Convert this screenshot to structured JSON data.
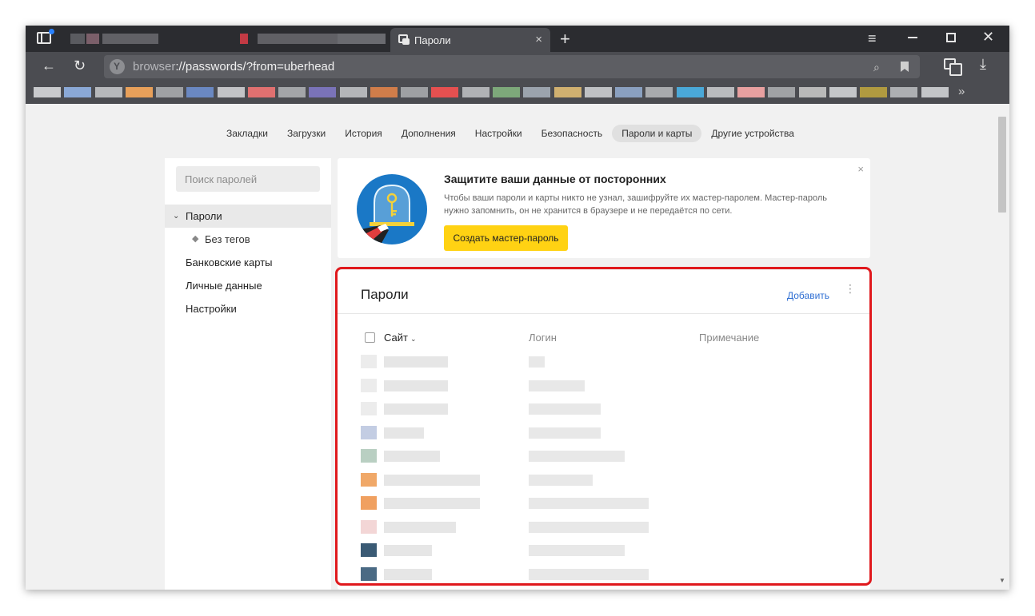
{
  "tabs": {
    "active": {
      "label": "Пароли",
      "close": "×"
    },
    "new_tab": "+",
    "blurred": [
      {
        "color": "#5a5b60",
        "w": 18
      },
      {
        "color": "#7b5f6a",
        "w": 16
      },
      {
        "color": "#616166",
        "w": 70
      },
      {
        "color": "#c23a44",
        "w": 10
      },
      {
        "color": "#606065",
        "w": 110
      },
      {
        "color": "#6a6b70",
        "w": 60
      }
    ]
  },
  "window_controls": {
    "menu": "≡",
    "close": "✕"
  },
  "navbar": {
    "back": "←",
    "reload": "↻",
    "url_scheme": "browser",
    "url_rest": "://passwords/?from=uberhead",
    "search_icon": "⌕",
    "download": "⤓"
  },
  "bookmarks": {
    "more": "»",
    "colors": [
      "#c9cacd",
      "#8aa8d6",
      "#b6b8bb",
      "#e8a05a",
      "#9fa1a4",
      "#6a88c2",
      "#c2c3c6",
      "#e07070",
      "#a3a5a8",
      "#7a73b8",
      "#b4b6b9",
      "#d07d4a",
      "#9ea0a3",
      "#e55050",
      "#b0b2b5",
      "#7da87a",
      "#9ba3ad",
      "#d0b070",
      "#bfc1c4",
      "#8aa0c0",
      "#a8aaad",
      "#4aa8d8",
      "#b9bbbe",
      "#e8a0a0",
      "#a0a2a5",
      "#b9b9b9",
      "#c4c6c9",
      "#b09a40",
      "#adafb2",
      "#c3c5c8"
    ]
  },
  "topnav": {
    "items": [
      "Закладки",
      "Загрузки",
      "История",
      "Дополнения",
      "Настройки",
      "Безопасность",
      "Пароли и карты",
      "Другие устройства"
    ],
    "active_index": 6
  },
  "sidebar": {
    "search_placeholder": "Поиск паролей",
    "passwords_chevron": "⌄",
    "passwords": "Пароли",
    "no_tags_icon": "◆",
    "no_tags": "Без тегов",
    "bank_cards": "Банковские карты",
    "personal_data": "Личные данные",
    "settings": "Настройки"
  },
  "promo": {
    "title": "Защитите ваши данные от посторонних",
    "text": "Чтобы ваши пароли и карты никто не узнал, зашифруйте их мастер-паролем. Мастер-пароль нужно запомнить, он не хранится в браузере и не передаётся по сети.",
    "button": "Создать мастер-пароль",
    "close": "×"
  },
  "passwords_card": {
    "title": "Пароли",
    "add": "Добавить",
    "kebab": "⋮",
    "columns": {
      "site": "Сайт",
      "sort_icon": "⌄",
      "login": "Логин",
      "note": "Примечание"
    },
    "rows": [
      {
        "fav": "#ececec",
        "site_w": 80,
        "login_w": 20
      },
      {
        "fav": "#ececec",
        "site_w": 80,
        "login_w": 70
      },
      {
        "fav": "#ececec",
        "site_w": 80,
        "login_w": 90
      },
      {
        "fav": "#c3cde3",
        "site_w": 50,
        "login_w": 90
      },
      {
        "fav": "#b9cfc2",
        "site_w": 70,
        "login_w": 120
      },
      {
        "fav": "#f0a868",
        "site_w": 120,
        "login_w": 80
      },
      {
        "fav": "#f0a060",
        "site_w": 120,
        "login_w": 150
      },
      {
        "fav": "#f3d6d6",
        "site_w": 90,
        "login_w": 150
      },
      {
        "fav": "#3a5a74",
        "site_w": 60,
        "login_w": 120
      },
      {
        "fav": "#4a6a84",
        "site_w": 60,
        "login_w": 150
      },
      {
        "fav": "#d8e8f2",
        "site_w": 90,
        "login_w": 90
      }
    ]
  },
  "scrollbar": {
    "down_arrow": "▼"
  }
}
